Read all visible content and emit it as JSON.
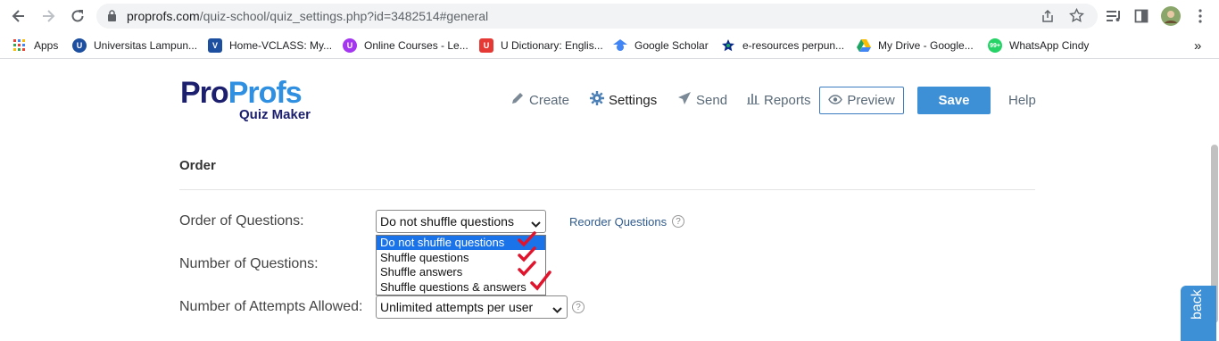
{
  "browser": {
    "url_host": "proprofs.com",
    "url_path": "/quiz-school/quiz_settings.php?id=3482514#general",
    "bookmarks": [
      {
        "label": "Apps",
        "icon": "apps-grid-icon"
      },
      {
        "label": "Universitas Lampun...",
        "icon": "university-icon"
      },
      {
        "label": "Home-VCLASS: My...",
        "icon": "vclass-icon"
      },
      {
        "label": "Online Courses - Le...",
        "icon": "udemy-icon"
      },
      {
        "label": "U Dictionary: Englis...",
        "icon": "dictionary-icon"
      },
      {
        "label": "Google Scholar",
        "icon": "scholar-icon"
      },
      {
        "label": "e-resources perpun...",
        "icon": "star-icon"
      },
      {
        "label": "My Drive - Google...",
        "icon": "drive-icon"
      },
      {
        "label": "WhatsApp Cindy",
        "icon": "whatsapp-icon"
      }
    ],
    "more_bookmarks": "»"
  },
  "logo": {
    "part1": "Pro",
    "part2": "Profs",
    "sub": "Quiz Maker"
  },
  "nav": {
    "create": "Create",
    "settings": "Settings",
    "send": "Send",
    "reports": "Reports",
    "preview": "Preview",
    "save": "Save",
    "help": "Help"
  },
  "section": {
    "title": "Order"
  },
  "form": {
    "order_label": "Order of Questions:",
    "order_value": "Do not shuffle questions",
    "reorder_link": "Reorder Questions",
    "number_label": "Number of Questions:",
    "attempts_label": "Number of Attempts Allowed:",
    "attempts_value": "Unlimited attempts per user"
  },
  "dropdown_options": [
    "Do not shuffle questions",
    "Shuffle questions",
    "Shuffle answers",
    "Shuffle questions & answers"
  ],
  "feedback": "back",
  "colors": {
    "accent": "#3d8fd6",
    "brand_dark": "#1b1f6e",
    "check": "#e0142c"
  }
}
